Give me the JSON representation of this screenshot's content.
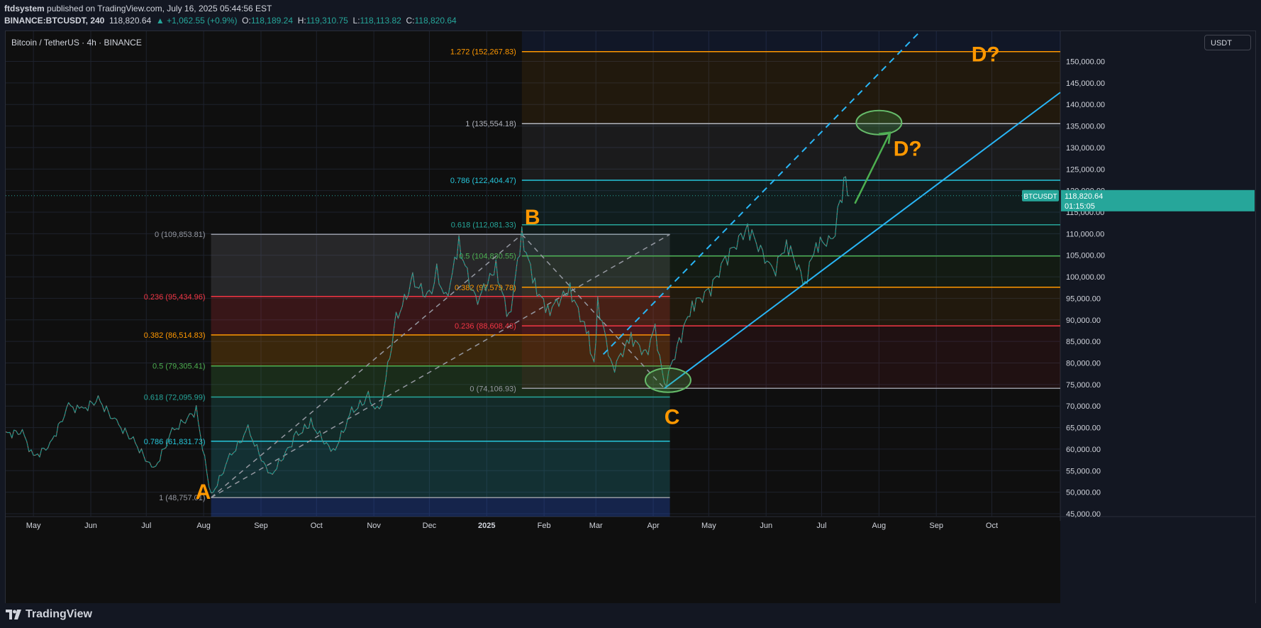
{
  "header": {
    "publisher": "ftdsystem",
    "published_text": "published on TradingView.com, July 16, 2025 05:44:56 EST",
    "symbol": "BINANCE:BTCUSDT, 240",
    "last": "118,820.64",
    "change": "▲ +1,062.55 (+0.9%)",
    "o_label": "O:",
    "o": "118,189.24",
    "h_label": "H:",
    "h": "119,310.75",
    "l_label": "L:",
    "l": "118,113.82",
    "c_label": "C:",
    "c": "118,820.64"
  },
  "chart_title": "Bitcoin / TetherUS · 4h · BINANCE",
  "currency": "USDT",
  "footer": {
    "logo_text": "TradingView"
  },
  "chart_data": {
    "type": "line",
    "title": "Bitcoin / TetherUS · 4h · BINANCE",
    "ylim": [
      45000,
      157000
    ],
    "y_ticks": [
      45000,
      50000,
      55000,
      60000,
      65000,
      70000,
      75000,
      80000,
      85000,
      90000,
      95000,
      100000,
      105000,
      110000,
      115000,
      120000,
      125000,
      130000,
      135000,
      140000,
      145000,
      150000
    ],
    "y_tick_labels": [
      "45,000.00",
      "50,000.00",
      "55,000.00",
      "60,000.00",
      "65,000.00",
      "70,000.00",
      "75,000.00",
      "80,000.00",
      "85,000.00",
      "90,000.00",
      "95,000.00",
      "100,000.00",
      "105,000.00",
      "110,000.00",
      "115,000.00",
      "120,000.00",
      "125,000.00",
      "130,000.00",
      "135,000.00",
      "140,000.00",
      "145,000.00",
      "150,000.00"
    ],
    "x_range": [
      "2024-04-16",
      "2025-11-07"
    ],
    "x_ticks": [
      {
        "label": "May",
        "date": "2024-05-01"
      },
      {
        "label": "Jun",
        "date": "2024-06-01"
      },
      {
        "label": "Jul",
        "date": "2024-07-01"
      },
      {
        "label": "Aug",
        "date": "2024-08-01"
      },
      {
        "label": "Sep",
        "date": "2024-09-01"
      },
      {
        "label": "Oct",
        "date": "2024-10-01"
      },
      {
        "label": "Nov",
        "date": "2024-11-01"
      },
      {
        "label": "Dec",
        "date": "2024-12-01"
      },
      {
        "label": "2025",
        "date": "2025-01-01"
      },
      {
        "label": "Feb",
        "date": "2025-02-01"
      },
      {
        "label": "Mar",
        "date": "2025-03-01"
      },
      {
        "label": "Apr",
        "date": "2025-04-01"
      },
      {
        "label": "May",
        "date": "2025-05-01"
      },
      {
        "label": "Jun",
        "date": "2025-06-01"
      },
      {
        "label": "Jul",
        "date": "2025-07-01"
      },
      {
        "label": "Aug",
        "date": "2025-08-01"
      },
      {
        "label": "Sep",
        "date": "2025-09-01"
      },
      {
        "label": "Oct",
        "date": "2025-10-01"
      }
    ],
    "series": [
      {
        "name": "BTCUSDT",
        "values": [
          {
            "x": "2024-04-16",
            "y": 63500
          },
          {
            "x": "2024-04-25",
            "y": 64000
          },
          {
            "x": "2024-05-01",
            "y": 58000
          },
          {
            "x": "2024-05-10",
            "y": 61000
          },
          {
            "x": "2024-05-20",
            "y": 70000
          },
          {
            "x": "2024-05-27",
            "y": 69000
          },
          {
            "x": "2024-06-05",
            "y": 71500
          },
          {
            "x": "2024-06-15",
            "y": 66000
          },
          {
            "x": "2024-06-24",
            "y": 62000
          },
          {
            "x": "2024-07-05",
            "y": 55000
          },
          {
            "x": "2024-07-15",
            "y": 64000
          },
          {
            "x": "2024-07-28",
            "y": 69000
          },
          {
            "x": "2024-08-05",
            "y": 49000
          },
          {
            "x": "2024-08-15",
            "y": 58000
          },
          {
            "x": "2024-08-25",
            "y": 64500
          },
          {
            "x": "2024-09-06",
            "y": 53500
          },
          {
            "x": "2024-09-20",
            "y": 63000
          },
          {
            "x": "2024-09-28",
            "y": 66000
          },
          {
            "x": "2024-10-10",
            "y": 59000
          },
          {
            "x": "2024-10-20",
            "y": 68500
          },
          {
            "x": "2024-10-29",
            "y": 72000
          },
          {
            "x": "2024-11-04",
            "y": 68000
          },
          {
            "x": "2024-11-13",
            "y": 90000
          },
          {
            "x": "2024-11-22",
            "y": 99000
          },
          {
            "x": "2024-12-01",
            "y": 95000
          },
          {
            "x": "2024-12-05",
            "y": 101000
          },
          {
            "x": "2024-12-10",
            "y": 94500
          },
          {
            "x": "2024-12-17",
            "y": 107500
          },
          {
            "x": "2024-12-26",
            "y": 94000
          },
          {
            "x": "2025-01-06",
            "y": 102000
          },
          {
            "x": "2025-01-13",
            "y": 90000
          },
          {
            "x": "2025-01-20",
            "y": 109600
          },
          {
            "x": "2025-01-27",
            "y": 98000
          },
          {
            "x": "2025-02-03",
            "y": 92000
          },
          {
            "x": "2025-02-15",
            "y": 97000
          },
          {
            "x": "2025-02-25",
            "y": 86000
          },
          {
            "x": "2025-02-28",
            "y": 79000
          },
          {
            "x": "2025-03-02",
            "y": 94000
          },
          {
            "x": "2025-03-10",
            "y": 78500
          },
          {
            "x": "2025-03-20",
            "y": 86000
          },
          {
            "x": "2025-03-28",
            "y": 82000
          },
          {
            "x": "2025-04-02",
            "y": 88000
          },
          {
            "x": "2025-04-07",
            "y": 74500
          },
          {
            "x": "2025-04-15",
            "y": 85000
          },
          {
            "x": "2025-04-22",
            "y": 93500
          },
          {
            "x": "2025-05-01",
            "y": 96500
          },
          {
            "x": "2025-05-10",
            "y": 104000
          },
          {
            "x": "2025-05-22",
            "y": 111500
          },
          {
            "x": "2025-06-05",
            "y": 101000
          },
          {
            "x": "2025-06-12",
            "y": 108000
          },
          {
            "x": "2025-06-22",
            "y": 98500
          },
          {
            "x": "2025-06-28",
            "y": 107500
          },
          {
            "x": "2025-07-07",
            "y": 108500
          },
          {
            "x": "2025-07-11",
            "y": 117500
          },
          {
            "x": "2025-07-14",
            "y": 123000
          },
          {
            "x": "2025-07-16",
            "y": 118820
          }
        ]
      }
    ],
    "fib_retracement_ab": {
      "from_date": "2024-08-05",
      "to_date": "2025-04-10",
      "levels": [
        {
          "label": "1 (48,757.01)",
          "value": 48757.01,
          "color": "#9598a1"
        },
        {
          "label": "0.786 (61,831.73)",
          "value": 61831.73,
          "color": "#26c6da"
        },
        {
          "label": "0.618 (72,095.99)",
          "value": 72095.99,
          "color": "#26a69a"
        },
        {
          "label": "0.5 (79,305.41)",
          "value": 79305.41,
          "color": "#4caf50"
        },
        {
          "label": "0.382 (86,514.83)",
          "value": 86514.83,
          "color": "#ff9800"
        },
        {
          "label": "0.236 (95,434.96)",
          "value": 95434.96,
          "color": "#f23645"
        },
        {
          "label": "0 (109,853.81)",
          "value": 109853.81,
          "color": "#9598a1"
        }
      ]
    },
    "fib_extension_bc": {
      "from_date": "2025-01-20",
      "levels": [
        {
          "label": "0 (74,106.93)",
          "value": 74106.93,
          "color": "#9598a1"
        },
        {
          "label": "0.236 (88,608.48)",
          "value": 88608.48,
          "color": "#f23645"
        },
        {
          "label": "0.382 (97,579.78)",
          "value": 97579.78,
          "color": "#ff9800"
        },
        {
          "label": "0.5 (104,830.55)",
          "value": 104830.55,
          "color": "#4caf50"
        },
        {
          "label": "0.618 (112,081.33)",
          "value": 112081.33,
          "color": "#26a69a"
        },
        {
          "label": "0.786 (122,404.47)",
          "value": 122404.47,
          "color": "#26c6da"
        },
        {
          "label": "1 (135,554.18)",
          "value": 135554.18,
          "color": "#b2b5be"
        },
        {
          "label": "1.272 (152,267.83)",
          "value": 152267.83,
          "color": "#ff9800"
        }
      ]
    },
    "waves": [
      {
        "label": "A",
        "x": "2024-08-05",
        "y": 48757
      },
      {
        "label": "B",
        "x": "2025-01-20",
        "y": 109853
      },
      {
        "label": "C",
        "x": "2025-04-07",
        "y": 74107
      },
      {
        "label": "D?",
        "x": "2025-09-20",
        "y": 150000
      },
      {
        "label": "D?",
        "x": "2025-08-05",
        "y": 133000
      }
    ],
    "price_tag": {
      "symbol": "BTCUSDT",
      "price": "118,820.64",
      "countdown": "01:15:05",
      "value": 118820.64
    }
  }
}
